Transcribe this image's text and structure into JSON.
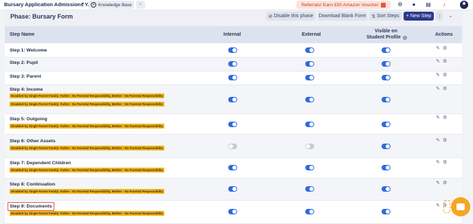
{
  "topbar": {
    "app_title": "Bursary Application Admissions Y...",
    "kb_label": "Knowledge Base",
    "referral_label": "Referrals! Earn £50 Amazon Voucher",
    "icons": [
      "apps-icon",
      "lightbulb-icon",
      "document-icon",
      "bell-icon",
      "avatar"
    ]
  },
  "phase": {
    "title": "Phase: Bursary Form",
    "disable_label": "Disable this phase",
    "download_label": "Download Blank Form",
    "sort_label": "Sort Steps",
    "new_step_label": "+ New Step"
  },
  "columns": {
    "step_name": "Step Name",
    "internal": "Internal",
    "external": "External",
    "visible_line1": "Visible on",
    "visible_line2": "Student Profile",
    "actions": "Actions"
  },
  "badge_text": "Disabled by Single Parent Family: Father - No Parental Responsibility, Mother - No Parental Responsibility",
  "steps": [
    {
      "name": "Step 1: Welcome",
      "internal": true,
      "external": true,
      "visible": true,
      "badges": 0
    },
    {
      "name": "Step 2: Pupil",
      "internal": true,
      "external": true,
      "visible": true,
      "badges": 0
    },
    {
      "name": "Step 3: Parent",
      "internal": true,
      "external": true,
      "visible": true,
      "badges": 0
    },
    {
      "name": "Step 4: Income",
      "internal": true,
      "external": true,
      "visible": true,
      "badges": 2
    },
    {
      "name": "Step 5: Outgoing",
      "internal": true,
      "external": true,
      "visible": true,
      "badges": 1
    },
    {
      "name": "Step 6: Other Assets",
      "internal": false,
      "external": false,
      "visible": true,
      "badges": 1
    },
    {
      "name": "Step 7: Dependent Children",
      "internal": true,
      "external": true,
      "visible": true,
      "badges": 1
    },
    {
      "name": "Step 8: Continuation",
      "internal": true,
      "external": true,
      "visible": true,
      "badges": 1
    },
    {
      "name": "Step 9: Documents",
      "internal": true,
      "external": true,
      "visible": true,
      "badges": 1
    }
  ]
}
